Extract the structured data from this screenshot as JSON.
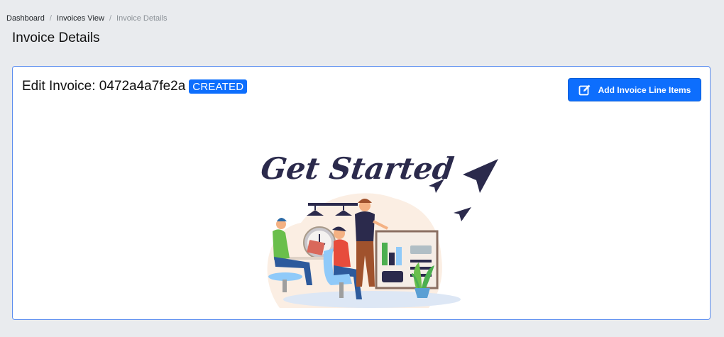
{
  "breadcrumb": {
    "items": [
      {
        "label": "Dashboard"
      },
      {
        "label": "Invoices View"
      },
      {
        "label": "Invoice Details"
      }
    ],
    "separator": "/"
  },
  "page": {
    "title": "Invoice Details"
  },
  "card": {
    "title_prefix": "Edit Invoice: ",
    "invoice_id": "0472a4a7fe2a",
    "status": "CREATED",
    "add_button_label": "Add Invoice Line Items",
    "add_button_icon": "edit-icon"
  },
  "illustration": {
    "heading": "Get Started"
  },
  "colors": {
    "primary": "#0d6efd",
    "card_border": "#5b8def",
    "background": "#e9ebee",
    "illustration_ink": "#2b2a4c"
  }
}
